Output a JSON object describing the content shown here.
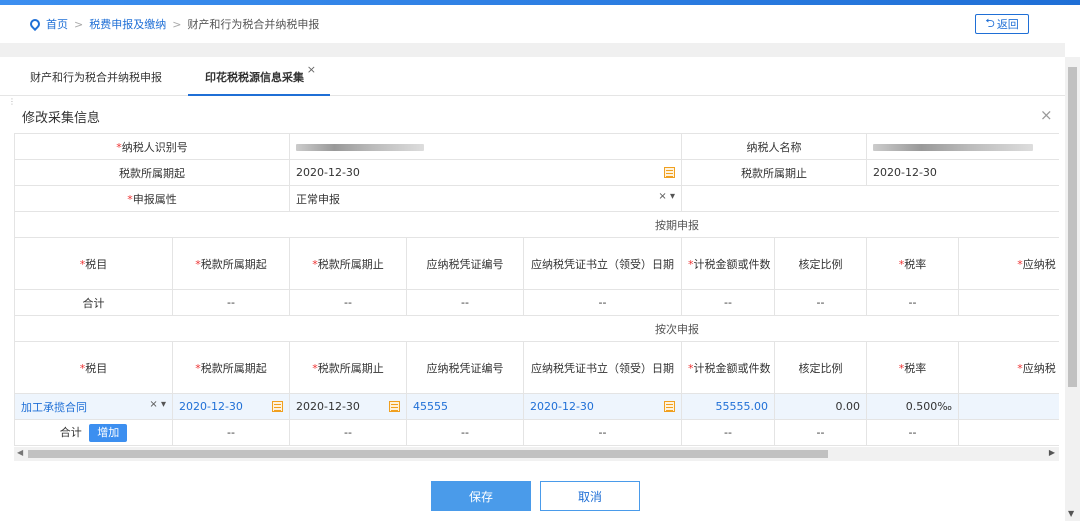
{
  "breadcrumb": {
    "home": "首页",
    "level2": "税费申报及缴纳",
    "current": "财产和行为税合并纳税申报"
  },
  "back_label": "返回",
  "tabs": [
    {
      "label": "财产和行为税合并纳税申报"
    },
    {
      "label": "印花税税源信息采集",
      "close": "×"
    }
  ],
  "modal": {
    "title": "修改采集信息",
    "close": "×"
  },
  "form": {
    "taxpayer_id_label": "纳税人识别号",
    "taxpayer_name_label": "纳税人名称",
    "period_start_label": "税款所属期起",
    "period_start_value": "2020-12-30",
    "period_end_label": "税款所属期止",
    "period_end_value": "2020-12-30",
    "declare_attr_label": "申报属性",
    "declare_attr_value": "正常申报",
    "select_clear": "×",
    "select_arrow": "▾"
  },
  "sections": {
    "periodic": "按期申报",
    "per_time": "按次申报"
  },
  "columns": [
    "税目",
    "税款所属期起",
    "税款所属期止",
    "应纳税凭证编号",
    "应纳税凭证书立（领受）日期",
    "计税金额或件数",
    "核定比例",
    "税率",
    "应纳税"
  ],
  "required_marks": [
    "*",
    "*",
    "*",
    "",
    "",
    "*",
    "",
    "*",
    "*"
  ],
  "total_label": "合计",
  "dash": "--",
  "edit_row": {
    "tax_item": "加工承揽合同",
    "start": "2020-12-30",
    "end": "2020-12-30",
    "voucher_no": "45555",
    "voucher_date": "2020-12-30",
    "amount": "55555.00",
    "ratio": "0.00",
    "rate": "0.500‰"
  },
  "add_label": "增加",
  "buttons": {
    "save": "保存",
    "cancel": "取消"
  },
  "colors": {
    "accent": "#1f6fd6",
    "button": "#4a9bea",
    "calendar": "#f0a020"
  }
}
